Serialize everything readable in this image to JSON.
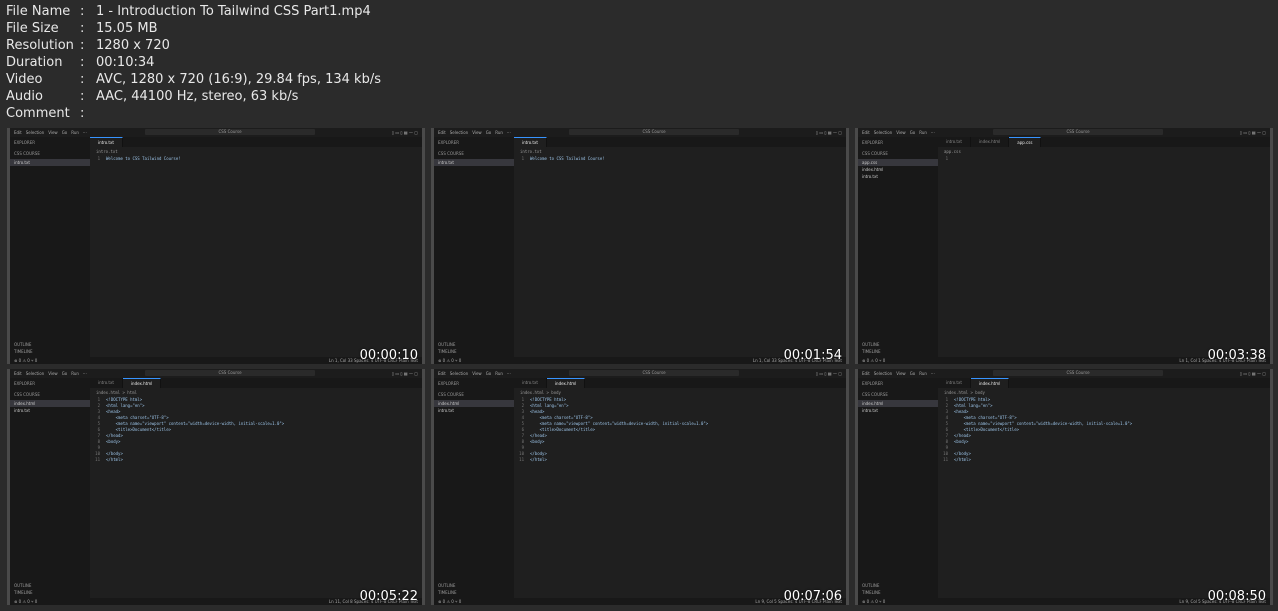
{
  "info": [
    {
      "key": "File Name",
      "value": "1 - Introduction To Tailwind CSS Part1.mp4"
    },
    {
      "key": "File Size",
      "value": "15.05 MB"
    },
    {
      "key": "Resolution",
      "value": "1280 x 720"
    },
    {
      "key": "Duration",
      "value": "00:10:34"
    },
    {
      "key": "Video",
      "value": "AVC, 1280 x 720 (16:9), 29.84 fps, 134 kb/s"
    },
    {
      "key": "Audio",
      "value": "AAC, 44100 Hz, stereo, 63 kb/s"
    },
    {
      "key": "Comment",
      "value": ""
    }
  ],
  "editor": {
    "menu": [
      "Edit",
      "Selection",
      "View",
      "Go",
      "Run",
      "···"
    ],
    "search": "CSS Course",
    "explorer": "EXPLORER",
    "folder": "CSS COURSE",
    "outline": "OUTLINE",
    "timeline": "TIMELINE",
    "problems": "⊗ 0 ⚠ 0   ⑂ 0",
    "status_rest": "Spaces: 4  UTF-8  CRLF  Plain Text"
  },
  "thumbs": [
    {
      "time": "00:00:10",
      "files": [
        "intro.txt"
      ],
      "active_file": 0,
      "tabs": [
        "intro.txt"
      ],
      "active_tab": 0,
      "breadcrumb": "intro.txt",
      "lines": [
        "Welcome to CSS Tailwind Course!"
      ],
      "status": "Ln 1, Col 33"
    },
    {
      "time": "00:01:54",
      "files": [
        "intro.txt"
      ],
      "active_file": 0,
      "tabs": [
        "intro.txt"
      ],
      "active_tab": 0,
      "breadcrumb": "intro.txt",
      "lines": [
        "Welcome to CSS Tailwind Course!"
      ],
      "status": "Ln 1, Col 33"
    },
    {
      "time": "00:03:38",
      "files": [
        "app.css",
        "index.html",
        "intro.txt"
      ],
      "active_file": 0,
      "tabs": [
        "intro.txt",
        "index.html",
        "app.css"
      ],
      "active_tab": 2,
      "breadcrumb": "app.css",
      "lines": [
        ""
      ],
      "status": "Ln 1, Col 1"
    },
    {
      "time": "00:05:22",
      "files": [
        "index.html",
        "intro.txt"
      ],
      "active_file": 0,
      "tabs": [
        "intro.txt",
        "index.html"
      ],
      "active_tab": 1,
      "breadcrumb": "index.html > html",
      "lines": [
        "<!DOCTYPE html>",
        "<html lang=\"en\">",
        "<head>",
        "    <meta charset=\"UTF-8\">",
        "    <meta name=\"viewport\" content=\"width=device-width, initial-scale=1.0\">",
        "    <title>Document</title>",
        "</head>",
        "<body>",
        "",
        "</body>",
        "</html>"
      ],
      "status": "Ln 11, Col 8"
    },
    {
      "time": "00:07:06",
      "files": [
        "index.html",
        "intro.txt"
      ],
      "active_file": 0,
      "tabs": [
        "intro.txt",
        "index.html"
      ],
      "active_tab": 1,
      "breadcrumb": "index.html > body",
      "lines": [
        "<!DOCTYPE html>",
        "<html lang=\"en\">",
        "<head>",
        "    <meta charset=\"UTF-8\">",
        "    <meta name=\"viewport\" content=\"width=device-width, initial-scale=1.0\">",
        "    <title>Document</title>",
        "</head>",
        "<body>",
        "",
        "</body>",
        "</html>"
      ],
      "status": "Ln 9, Col 5"
    },
    {
      "time": "00:08:50",
      "files": [
        "index.html",
        "intro.txt"
      ],
      "active_file": 0,
      "tabs": [
        "intro.txt",
        "index.html"
      ],
      "active_tab": 1,
      "breadcrumb": "index.html > body",
      "lines": [
        "<!DOCTYPE html>",
        "<html lang=\"en\">",
        "<head>",
        "    <meta charset=\"UTF-8\">",
        "    <meta name=\"viewport\" content=\"width=device-width, initial-scale=1.0\">",
        "    <title>Document</title>",
        "</head>",
        "<body>",
        "",
        "</body>",
        "</html>"
      ],
      "status": "Ln 9, Col 5"
    }
  ]
}
